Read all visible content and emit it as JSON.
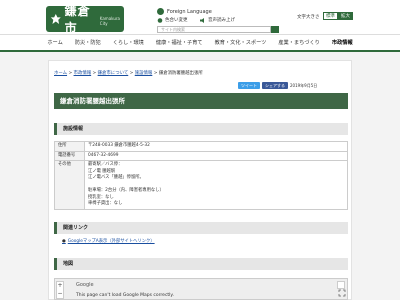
{
  "header": {
    "logo_text": "鎌倉市",
    "logo_sub": "Kamakura City",
    "foreign_language": "Foreign Language",
    "util_links": [
      {
        "label": "色合い変更",
        "icon": "palette-icon"
      },
      {
        "label": "音声読み上げ",
        "icon": "speaker-icon"
      }
    ],
    "search_placeholder": "サイト内検索",
    "text_size_label": "文字大きさ",
    "text_size_std": "標準",
    "text_size_big": "拡大"
  },
  "nav": {
    "items": [
      "ホーム",
      "防災・防犯",
      "くらし・環境",
      "健康・福祉・子育て",
      "教育・文化・スポーツ",
      "産業・まちづくり",
      "市政情報"
    ],
    "active_index": 6
  },
  "breadcrumb": {
    "items": [
      "ホーム",
      "市政情報",
      "鎌倉市について",
      "施設情報",
      "鎌倉消防署腰越出張所"
    ],
    "separator": ">"
  },
  "share": {
    "tweet": "ツイート",
    "facebook": "シェアする"
  },
  "update_date": "2019年9月5日",
  "page_title": "鎌倉消防署腰越出張所",
  "sections": {
    "facility": "施設情報",
    "related": "関連リンク",
    "map": "地図"
  },
  "info_rows": [
    {
      "key": "住所",
      "lines": [
        "〒248-0033 鎌倉市腰越4-5-32"
      ]
    },
    {
      "key": "電話番号",
      "lines": [
        "0467-32-4699"
      ]
    },
    {
      "key": "その他",
      "lines": [
        "最寄駅／バス停：",
        "江ノ電 腰越駅",
        "江ノ電バス「腰越」停留所。",
        "",
        "駐車場：2台分（内、障害者専用なし）",
        "授乳室：なし",
        "車椅子貸出：なし"
      ]
    }
  ],
  "related_link": "GoogleマップA表示（外部サイトへリンク）",
  "map": {
    "brand": "Google",
    "message": "This page can't load Google Maps correctly.",
    "zoom_in": "+",
    "zoom_out": "−"
  },
  "colors": {
    "brand_green": "#2f6a3b",
    "title_green": "#3f6746",
    "link_blue": "#1a4fa0"
  }
}
